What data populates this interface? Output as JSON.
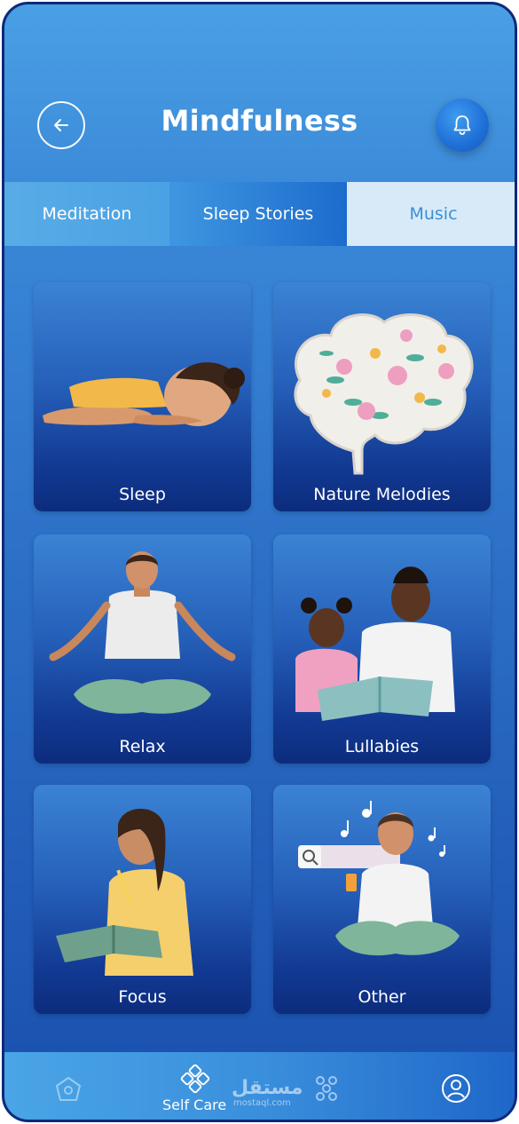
{
  "header": {
    "title": "Mindfulness",
    "back_icon": "arrow-left-icon",
    "notification_icon": "bell-icon"
  },
  "tabs": [
    {
      "label": "Meditation",
      "active": false
    },
    {
      "label": "Sleep Stories",
      "active": false
    },
    {
      "label": "Music",
      "active": true
    }
  ],
  "categories": [
    {
      "label": "Sleep",
      "illustration": "person-sleeping"
    },
    {
      "label": "Nature Melodies",
      "illustration": "floral-brain"
    },
    {
      "label": "Relax",
      "illustration": "person-meditating"
    },
    {
      "label": "Lullabies",
      "illustration": "parent-reading-to-child"
    },
    {
      "label": "Focus",
      "illustration": "person-reading-book"
    },
    {
      "label": "Other",
      "illustration": "person-with-phone-music-notes"
    }
  ],
  "bottom_nav": {
    "items": [
      {
        "icon": "home-icon",
        "label": ""
      },
      {
        "icon": "self-care-icon",
        "label": "Self Care",
        "active": true
      },
      {
        "icon": "community-icon",
        "label": ""
      },
      {
        "icon": "profile-icon",
        "label": ""
      }
    ]
  },
  "watermark": {
    "text": "مستقل",
    "sub": "mostaql.com"
  },
  "colors": {
    "background": "#3a88d8",
    "active_tab_bg": "#d8eaf8",
    "active_tab_text": "#3a8fd6",
    "card_top": "#3b83d4",
    "card_bottom": "#0c2c7d",
    "text": "#ffffff"
  }
}
